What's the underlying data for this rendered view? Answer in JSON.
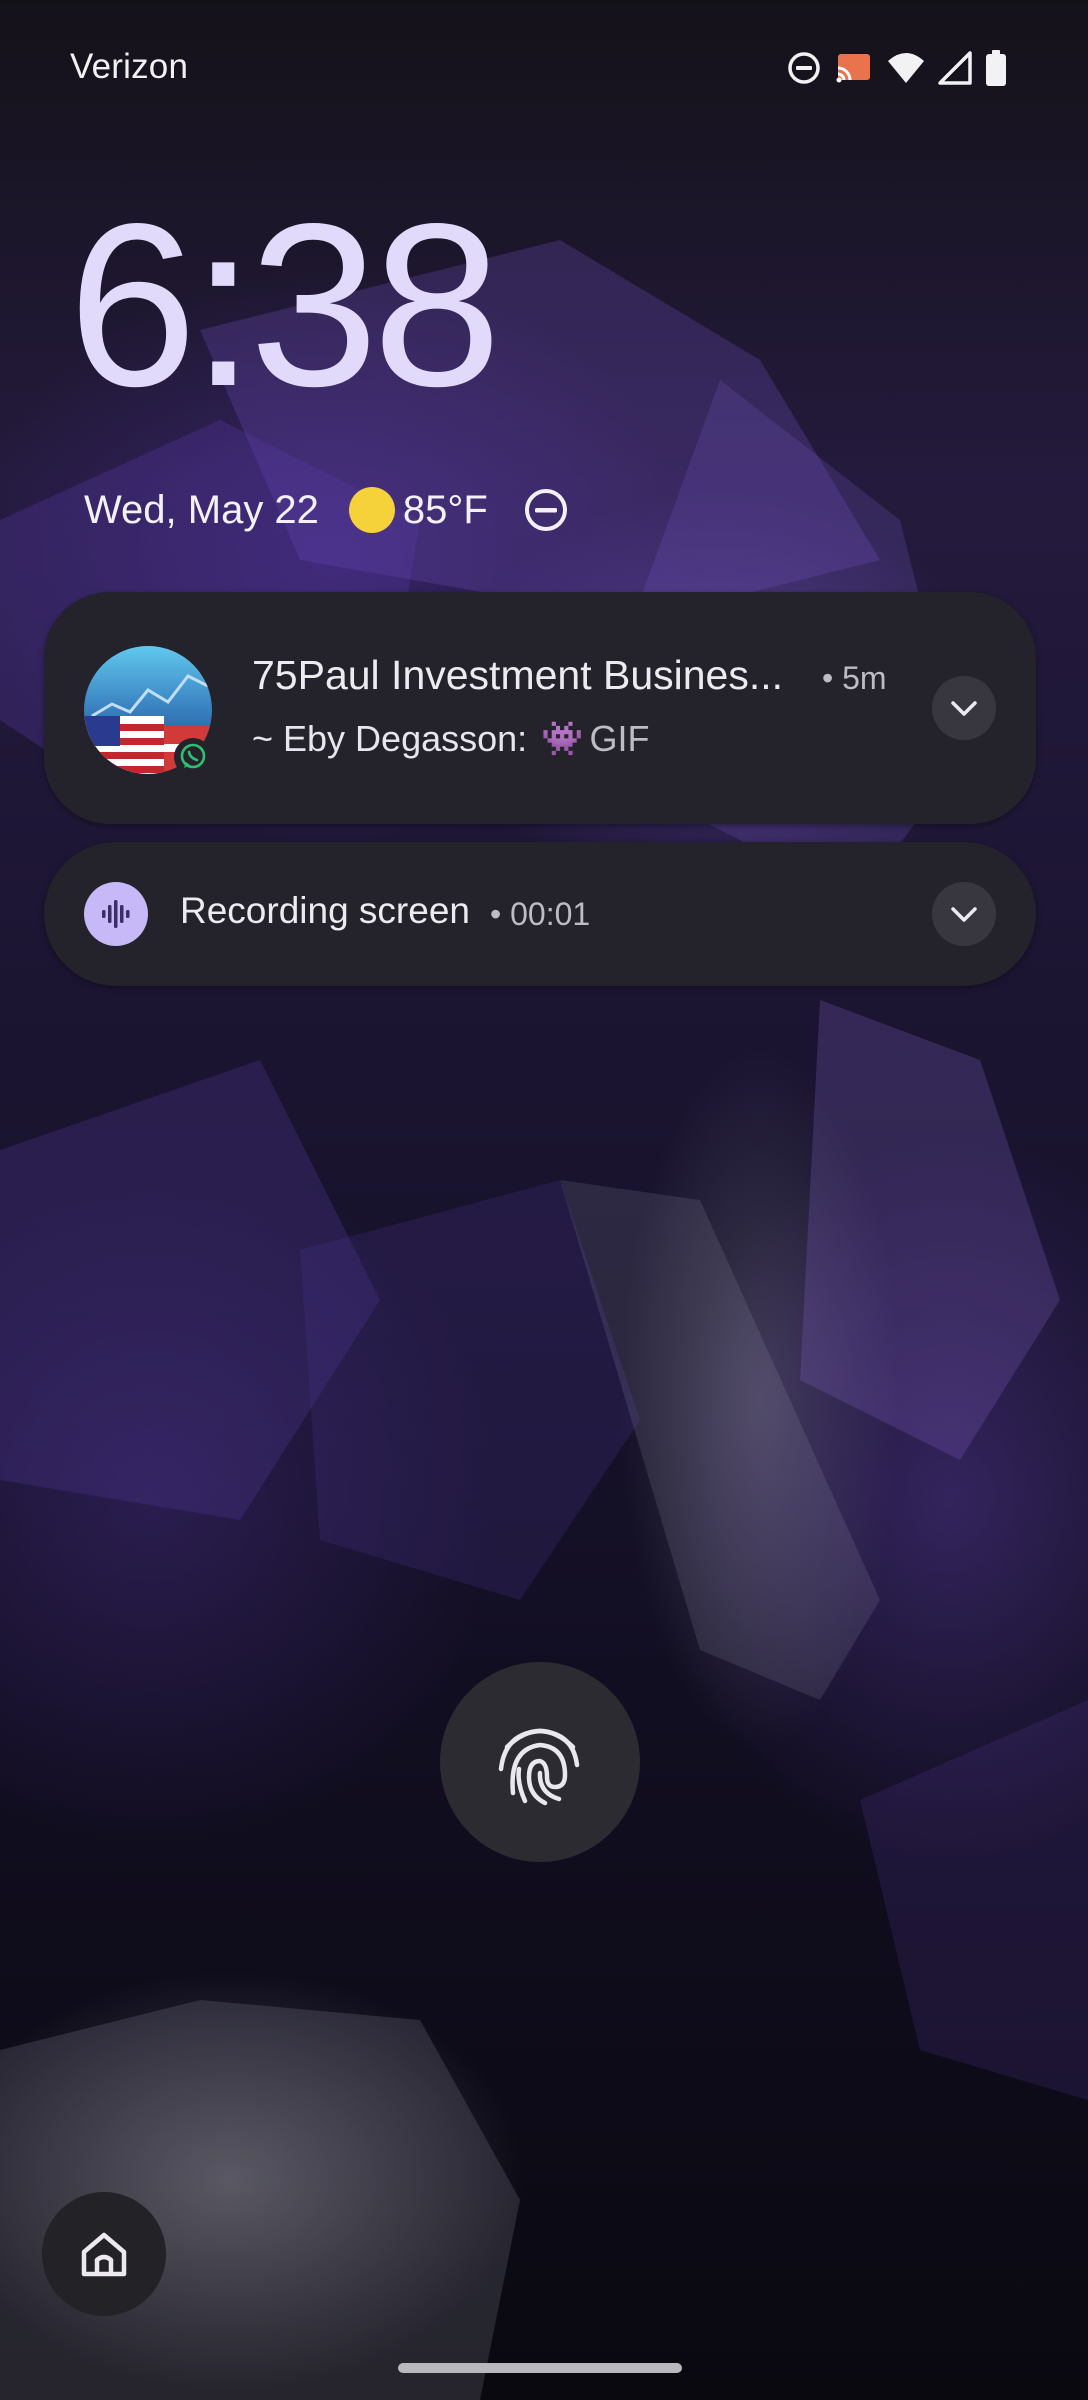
{
  "status_bar": {
    "carrier": "Verizon",
    "icons": [
      "dnd-icon",
      "cast-icon",
      "wifi-icon",
      "signal-icon",
      "battery-icon"
    ]
  },
  "lockscreen": {
    "time": "6:38",
    "date": "Wed, May 22",
    "weather_icon": "sun-icon",
    "temperature": "85°F",
    "dnd_icon": "dnd-icon"
  },
  "notifications": [
    {
      "app": "whatsapp",
      "title": "75Paul Investment Busines...",
      "time": "• 5m",
      "sender": "~ Eby Degasson:",
      "emoji": "👾",
      "message": "GIF"
    },
    {
      "app": "screen-recorder",
      "title": "Recording screen",
      "time": "• 00:01"
    }
  ],
  "colors": {
    "clock": "#e1dafa",
    "notification_bg": "#24222a",
    "recorder_accent": "#c7b8f8",
    "sun": "#f6d23a"
  }
}
